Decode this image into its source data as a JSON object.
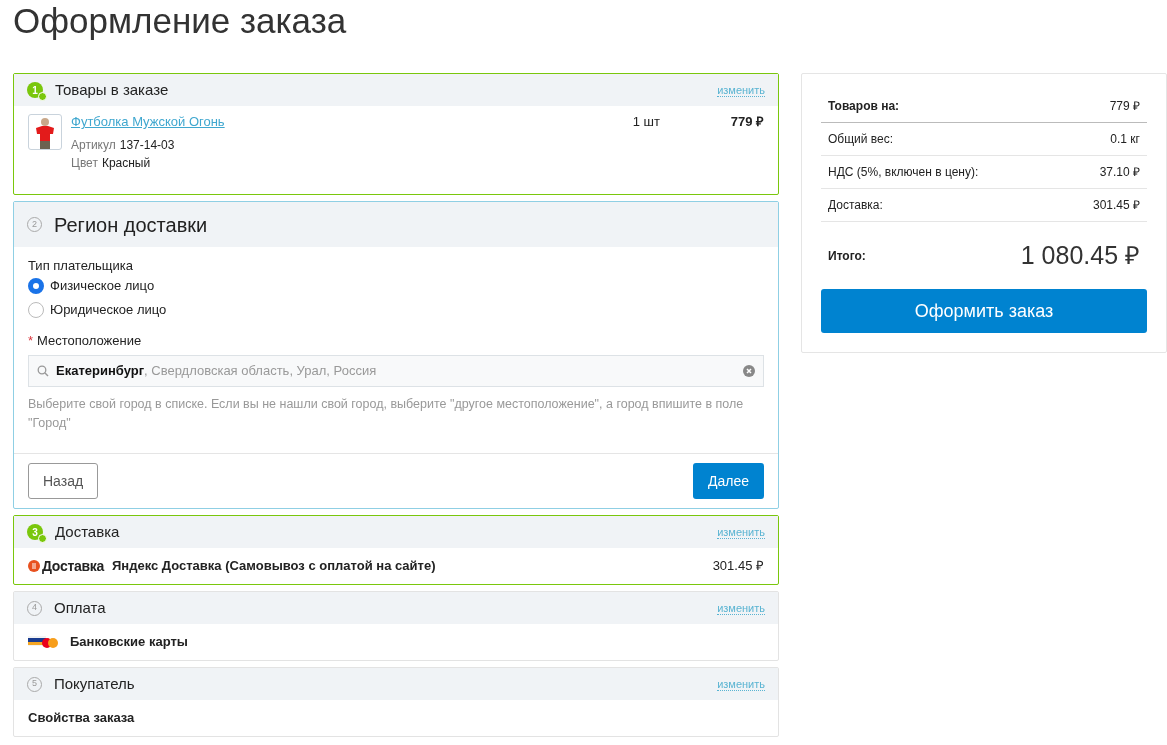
{
  "page_title": "Оформление заказа",
  "steps": [
    {
      "kind": "products",
      "number": "1",
      "title": "Товары в заказе",
      "completed": true,
      "active": false,
      "change_link": "изменить",
      "items": [
        {
          "name": "Футболка Мужской Огонь",
          "props": [
            {
              "label": "Артикул",
              "value": "137-14-03"
            },
            {
              "label": "Цвет",
              "value": "Красный"
            }
          ],
          "quantity": "1 шт",
          "price": "779 ₽"
        }
      ]
    },
    {
      "kind": "region",
      "number": "2",
      "title": "Регион доставки",
      "completed": false,
      "active": true,
      "payer_label": "Тип плательщика",
      "payer_options": [
        {
          "label": "Физическое лицо",
          "selected": true
        },
        {
          "label": "Юридическое лицо",
          "selected": false
        }
      ],
      "location_label": "Местоположение",
      "required_mark": "*",
      "location_city": "Екатеринбург",
      "location_rest": ", Свердловская область, Урал, Россия",
      "hint": "Выберите свой город в списке. Если вы не нашли свой город, выберите \"другое местоположение\", а город впишите в поле \"Город\"",
      "back_button": "Назад",
      "next_button": "Далее"
    },
    {
      "kind": "delivery",
      "number": "3",
      "title": "Доставка",
      "completed": true,
      "active": false,
      "change_link": "изменить",
      "logo_text": "Доставка",
      "service": "Яндекс Доставка (Самовывоз с оплатой на сайте)",
      "price": "301.45 ₽"
    },
    {
      "kind": "payment",
      "number": "4",
      "title": "Оплата",
      "completed": false,
      "active": false,
      "change_link": "изменить",
      "method": "Банковские карты"
    },
    {
      "kind": "buyer",
      "number": "5",
      "title": "Покупатель",
      "completed": false,
      "active": false,
      "change_link": "изменить",
      "text": "Свойства заказа"
    }
  ],
  "summary": {
    "rows": [
      {
        "label": "Товаров на:",
        "value": "779 ₽",
        "bold": true
      },
      {
        "label": "Общий вес:",
        "value": "0.1 кг",
        "bold": false
      },
      {
        "label": "НДС (5%, включен в цену):",
        "value": "37.10 ₽",
        "bold": false
      },
      {
        "label": "Доставка:",
        "value": "301.45 ₽",
        "bold": false
      }
    ],
    "total_label": "Итого:",
    "total_value": "1 080.45 ₽",
    "checkout_button": "Оформить заказ"
  }
}
